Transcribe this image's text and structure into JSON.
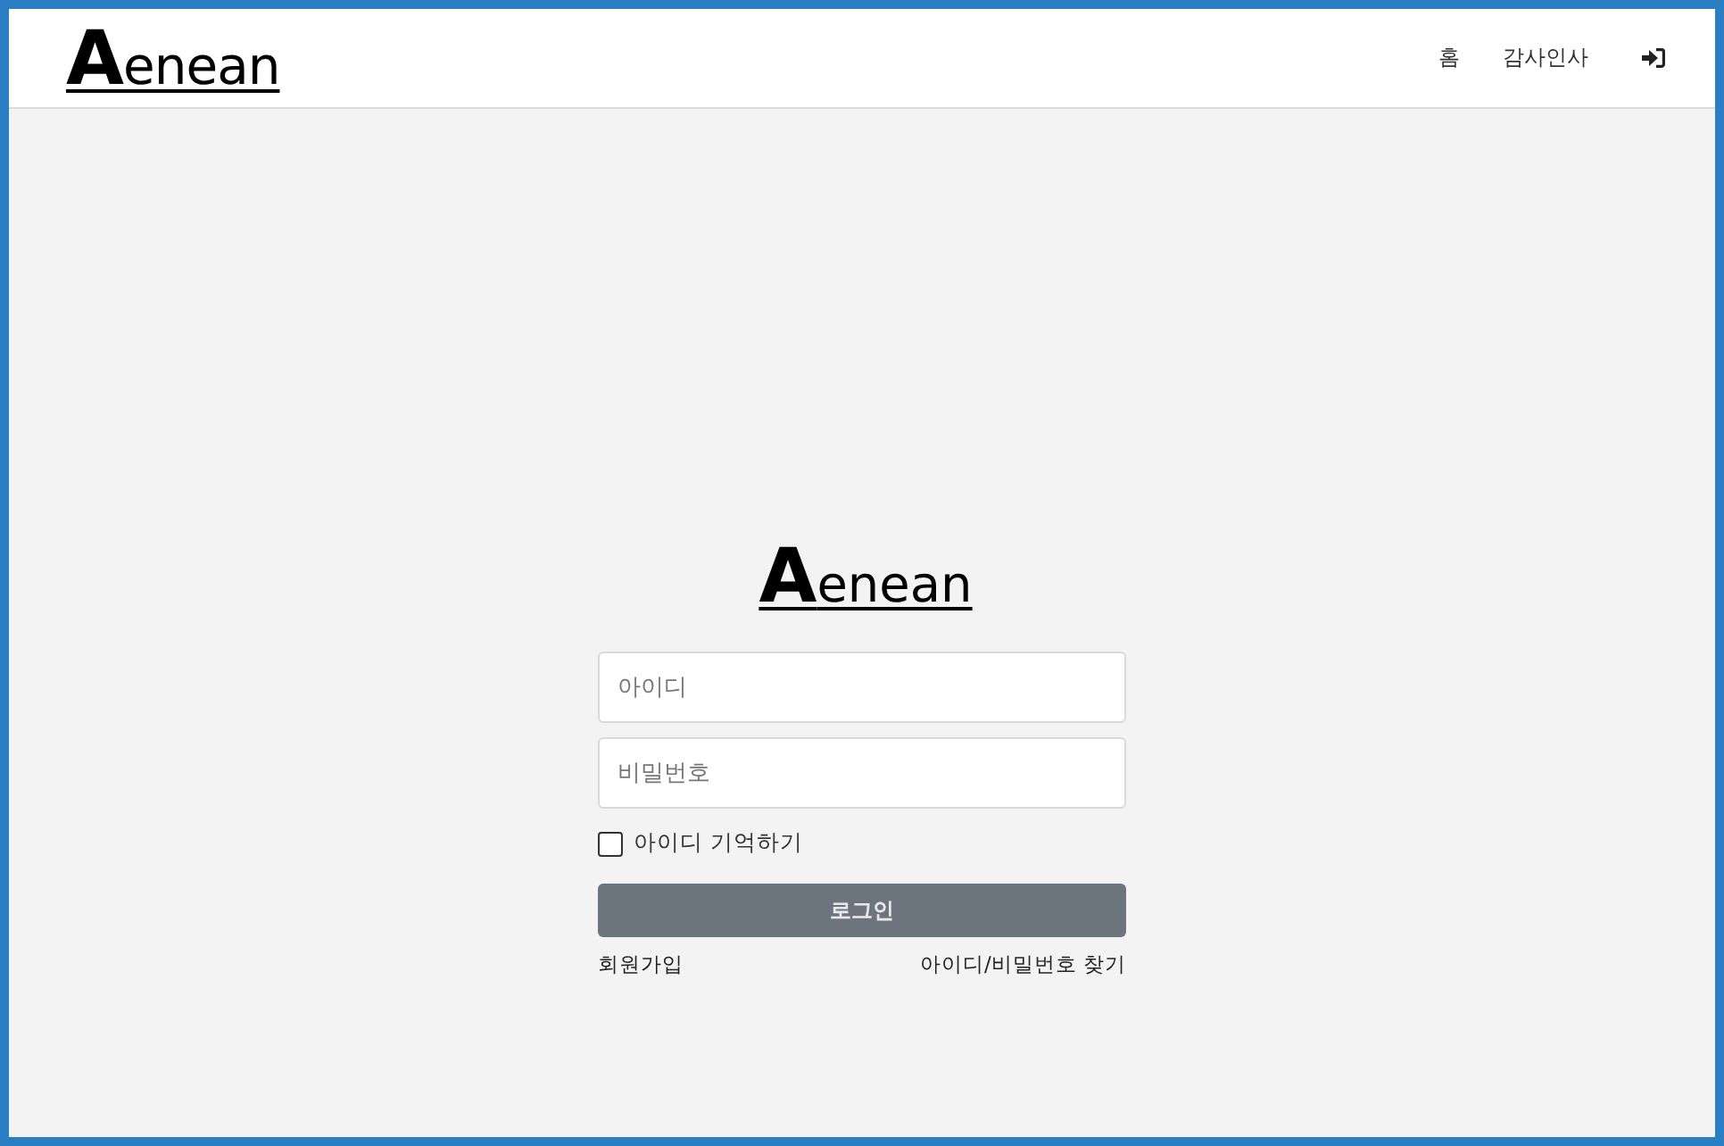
{
  "header": {
    "logo": "**A**enean",
    "nav": [
      {
        "kind": "text",
        "label": "홈"
      },
      {
        "kind": "text",
        "label": "감사인사"
      },
      {
        "kind": "icon"
      }
    ]
  },
  "login": {
    "logo": "**A**enean",
    "id_field": {
      "placeholder": "아이디"
    },
    "password_field": {
      "placeholder": "비밀번호"
    },
    "remember": {
      "label": "아이디 기억하기",
      "checked": false
    },
    "submit": {
      "label": "로그인",
      "disabled": true
    },
    "links": [
      "회원가입",
      "아이디/비밀번호 찾기"
    ]
  }
}
